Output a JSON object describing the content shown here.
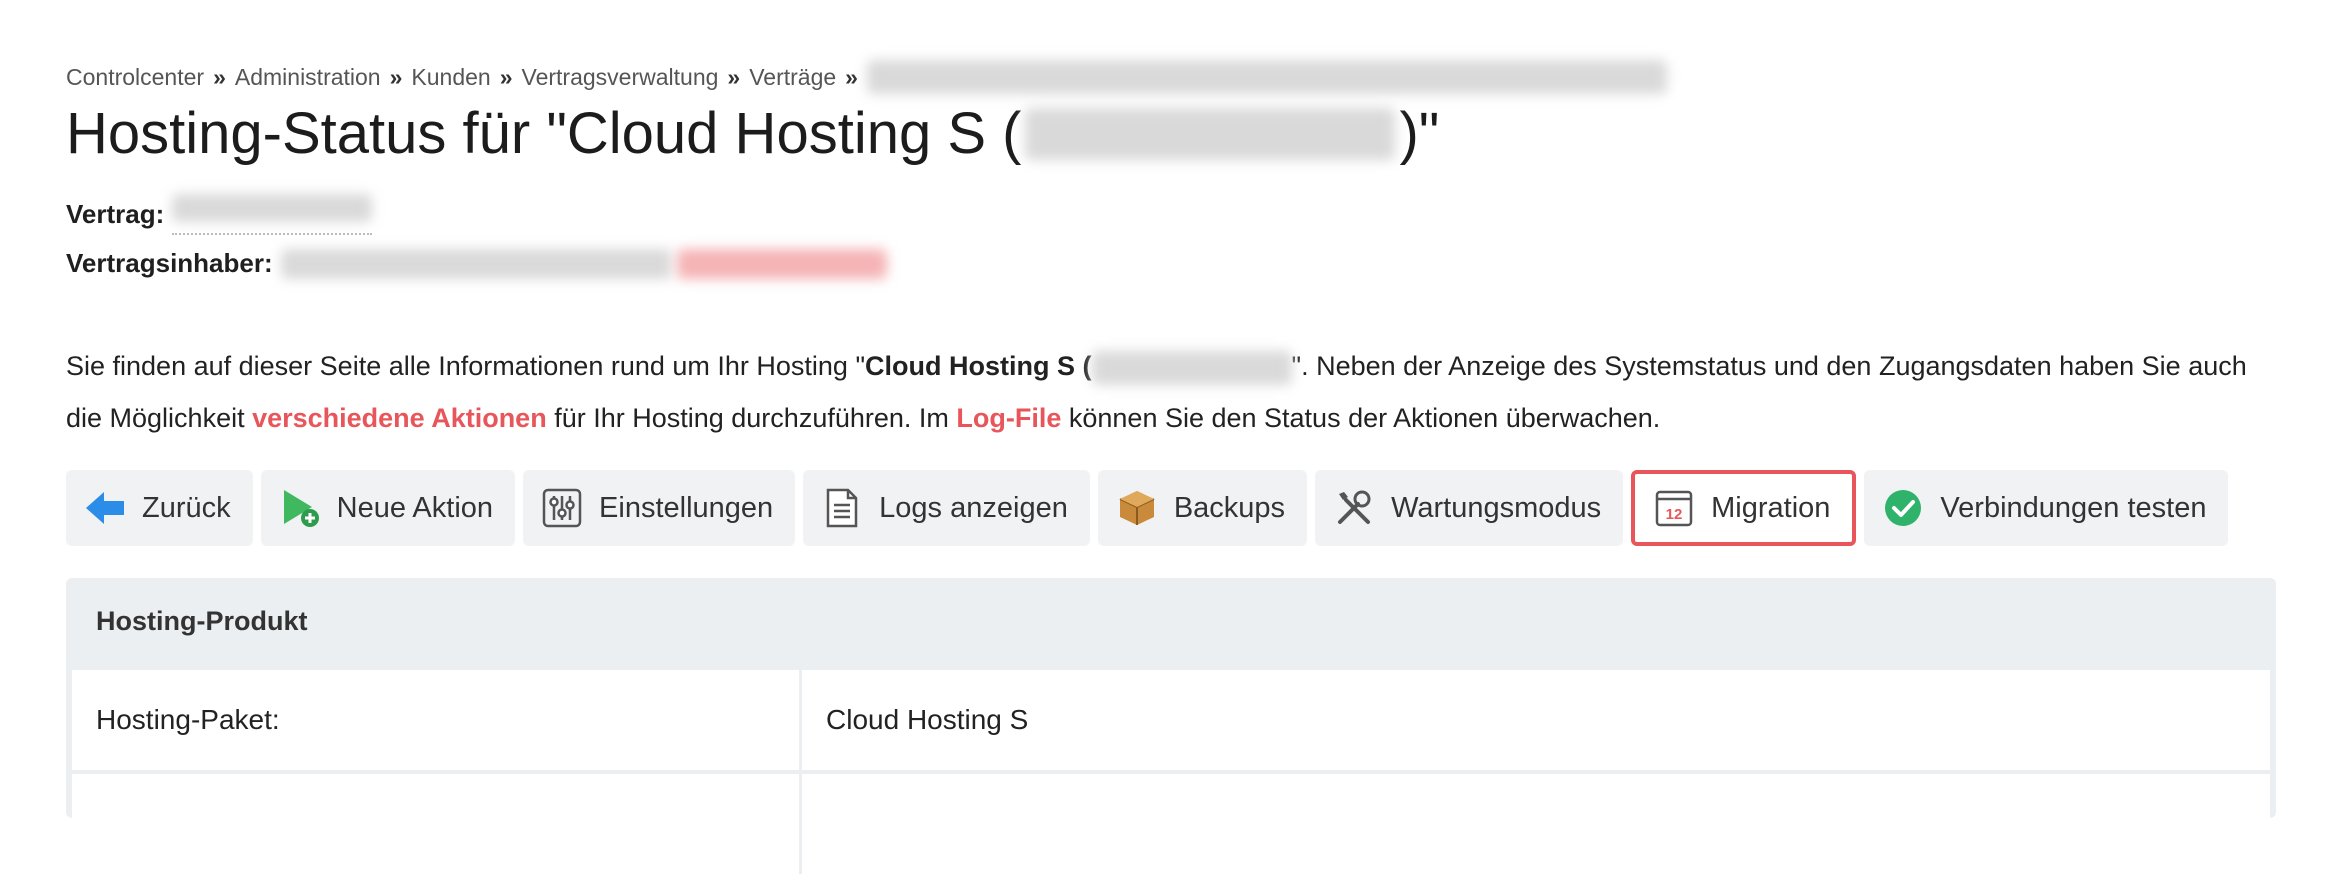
{
  "breadcrumb": {
    "items": [
      "Controlcenter",
      "Administration",
      "Kunden",
      "Vertragsverwaltung",
      "Verträge"
    ],
    "separator": "»"
  },
  "page": {
    "title_prefix": "Hosting-Status für \"Cloud Hosting S (",
    "title_suffix": ")\""
  },
  "meta": {
    "contract_label": "Vertrag:",
    "owner_label": "Vertragsinhaber:"
  },
  "description": {
    "p1": "Sie finden auf dieser Seite alle Informationen rund um Ihr Hosting \"",
    "p1_bold": "Cloud Hosting S (",
    "p2": "\". Neben der Anzeige des Systemstatus und den Zugangsdaten haben Sie auch die Möglichkeit ",
    "link_actions": "verschiedene Aktionen",
    "p3": " für Ihr Hosting durchzuführen. Im ",
    "link_log": "Log-File",
    "p4": " können Sie den Status der Aktionen überwachen."
  },
  "toolbar": {
    "back": "Zurück",
    "new_action": "Neue Aktion",
    "settings": "Einstellungen",
    "logs": "Logs anzeigen",
    "backups": "Backups",
    "maintenance": "Wartungsmodus",
    "migration": "Migration",
    "migration_icon_text": "12",
    "test_connections": "Verbindungen testen"
  },
  "panel": {
    "heading": "Hosting-Produkt",
    "rows": [
      {
        "label": "Hosting-Paket:",
        "value": "Cloud Hosting S"
      },
      {
        "label": "",
        "value": ""
      }
    ]
  },
  "colors": {
    "accent": "#e8555b",
    "button_bg": "#f1f2f4",
    "panel_bg": "#eceff2"
  }
}
